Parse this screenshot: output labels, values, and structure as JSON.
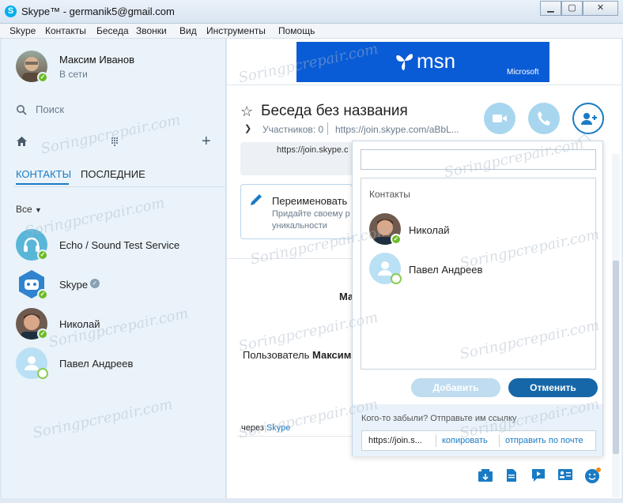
{
  "window": {
    "title": "Skype™ - germanik5@gmail.com",
    "logo_letter": "S"
  },
  "menu": [
    "Skype",
    "Контакты",
    "Беседа",
    "Звонки",
    "Вид",
    "Инструменты",
    "Помощь"
  ],
  "profile": {
    "name": "Максим Иванов",
    "status": "В сети"
  },
  "search": {
    "placeholder": "Поиск"
  },
  "tabs": {
    "contacts": "КОНТАКТЫ",
    "recent": "ПОСЛЕДНИЕ"
  },
  "filter": {
    "label": "Все"
  },
  "contacts": [
    {
      "name": "Echo / Sound Test Service"
    },
    {
      "name": "Skype"
    },
    {
      "name": "Николай"
    },
    {
      "name": "Павел Андреев"
    }
  ],
  "banner": {
    "brand": "msn",
    "company": "Microsoft"
  },
  "conversation": {
    "title": "Беседа без названия",
    "participants": "Участников: 0",
    "link": "https://join.skype.com/aBbL...",
    "link_partial": "https://join.skype.c"
  },
  "rename_card": {
    "title": "Переименовать",
    "desc_line1": "Придайте своему р",
    "desc_line2": "уникальности"
  },
  "chat": {
    "name_partial": "Ма",
    "user_line_prefix": "Пользователь ",
    "user_line_bold": "Максим",
    "via_prefix": "через ",
    "via_link": "Skype"
  },
  "popup": {
    "input_value": "",
    "section_title": "Контакты",
    "contacts": [
      {
        "name": "Николай"
      },
      {
        "name": "Павел Андреев"
      }
    ],
    "add_button": "Добавить",
    "cancel_button": "Отменить",
    "forgot_text": "Кого-то забыли? Отправьте им ссылку",
    "link_short": "https://join.s...",
    "copy_link": "копировать",
    "send_email": "отправить по почте"
  },
  "watermark": "Soringpcrepair.com",
  "colors": {
    "accent": "#1a7bc4",
    "online": "#6dbb27",
    "skype_blue": "#00aff0"
  }
}
